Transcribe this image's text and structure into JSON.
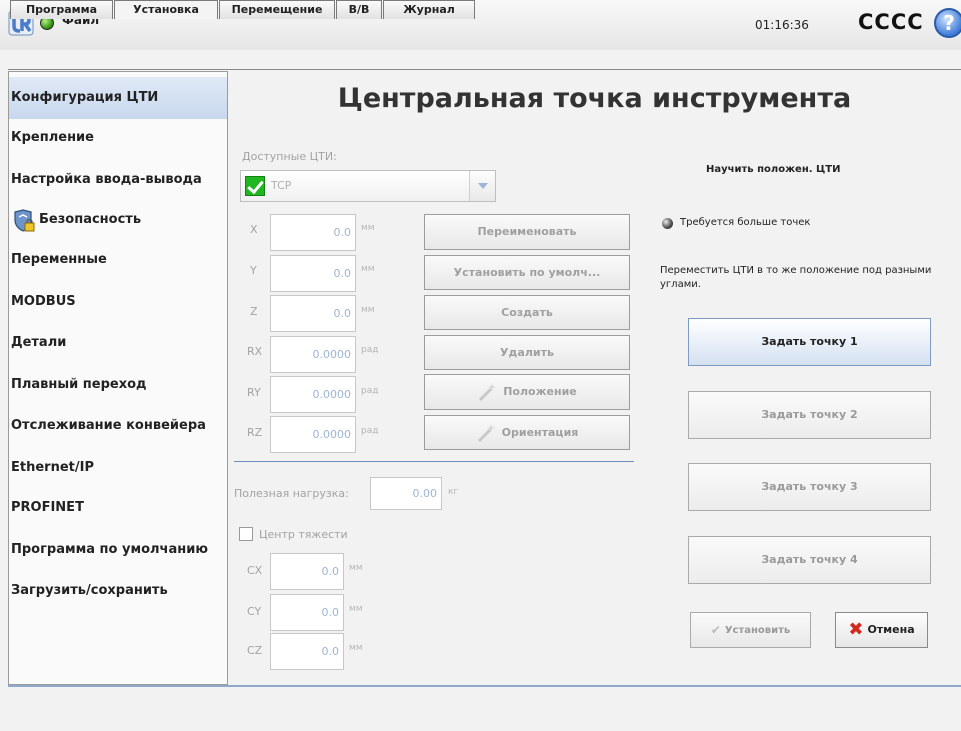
{
  "header": {
    "file_menu": "Файл",
    "clock": "01:16:36",
    "robot_name": "CCCC",
    "help": "?"
  },
  "tabs": [
    {
      "label": "Программа"
    },
    {
      "label": "Установка",
      "active": true
    },
    {
      "label": "Перемещение"
    },
    {
      "label": "В/В"
    },
    {
      "label": "Журнал"
    }
  ],
  "sidebar": {
    "items": [
      {
        "label": "Конфигурация ЦТИ",
        "active": true
      },
      {
        "label": "Крепление"
      },
      {
        "label": "Настройка ввода-вывода"
      },
      {
        "label": "Безопасность",
        "icon": "shield-lock-icon"
      },
      {
        "label": "Переменные"
      },
      {
        "label": "MODBUS"
      },
      {
        "label": "Детали"
      },
      {
        "label": "Плавный переход"
      },
      {
        "label": "Отслеживание конвейера"
      },
      {
        "label": "Ethernet/IP"
      },
      {
        "label": "PROFINET"
      },
      {
        "label": "Программа по умолчанию"
      },
      {
        "label": "Загрузить/сохранить"
      }
    ]
  },
  "main": {
    "title": "Центральная точка инструмента",
    "available_label": "Доступные ЦТИ:",
    "tcp_selected": "TCP",
    "fields": {
      "x": {
        "label": "X",
        "value": "0.0",
        "unit": "мм"
      },
      "y": {
        "label": "Y",
        "value": "0.0",
        "unit": "мм"
      },
      "z": {
        "label": "Z",
        "value": "0.0",
        "unit": "мм"
      },
      "rx": {
        "label": "RX",
        "value": "0.0000",
        "unit": "рад"
      },
      "ry": {
        "label": "RY",
        "value": "0.0000",
        "unit": "рад"
      },
      "rz": {
        "label": "RZ",
        "value": "0.0000",
        "unit": "рад"
      }
    },
    "buttons": {
      "rename": "Переименовать",
      "set_default": "Установить по умолч...",
      "create": "Создать",
      "delete": "Удалить",
      "position": "Положение",
      "orientation": "Ориентация"
    },
    "payload": {
      "label": "Полезная нагрузка:",
      "value": "0.00",
      "unit": "кг"
    },
    "cog": {
      "label": "Центр тяжести",
      "checked": false,
      "cx": {
        "label": "CX",
        "value": "0.0",
        "unit": "мм"
      },
      "cy": {
        "label": "CY",
        "value": "0.0",
        "unit": "мм"
      },
      "cz": {
        "label": "CZ",
        "value": "0.0",
        "unit": "мм"
      }
    }
  },
  "teach": {
    "title": "Научить положен. ЦТИ",
    "status": "Требуется больше точек",
    "instruction": "Переместить ЦТИ в то же положение под разными углами.",
    "points": [
      {
        "label": "Задать точку 1",
        "active": true
      },
      {
        "label": "Задать точку 2"
      },
      {
        "label": "Задать точку 3"
      },
      {
        "label": "Задать точку 4"
      }
    ],
    "apply": "Установить",
    "cancel": "Отмена"
  },
  "colors": {
    "accent": "#c9d8ee",
    "status_ok": "#3a9a18",
    "cancel_icon": "#d12a1c"
  }
}
